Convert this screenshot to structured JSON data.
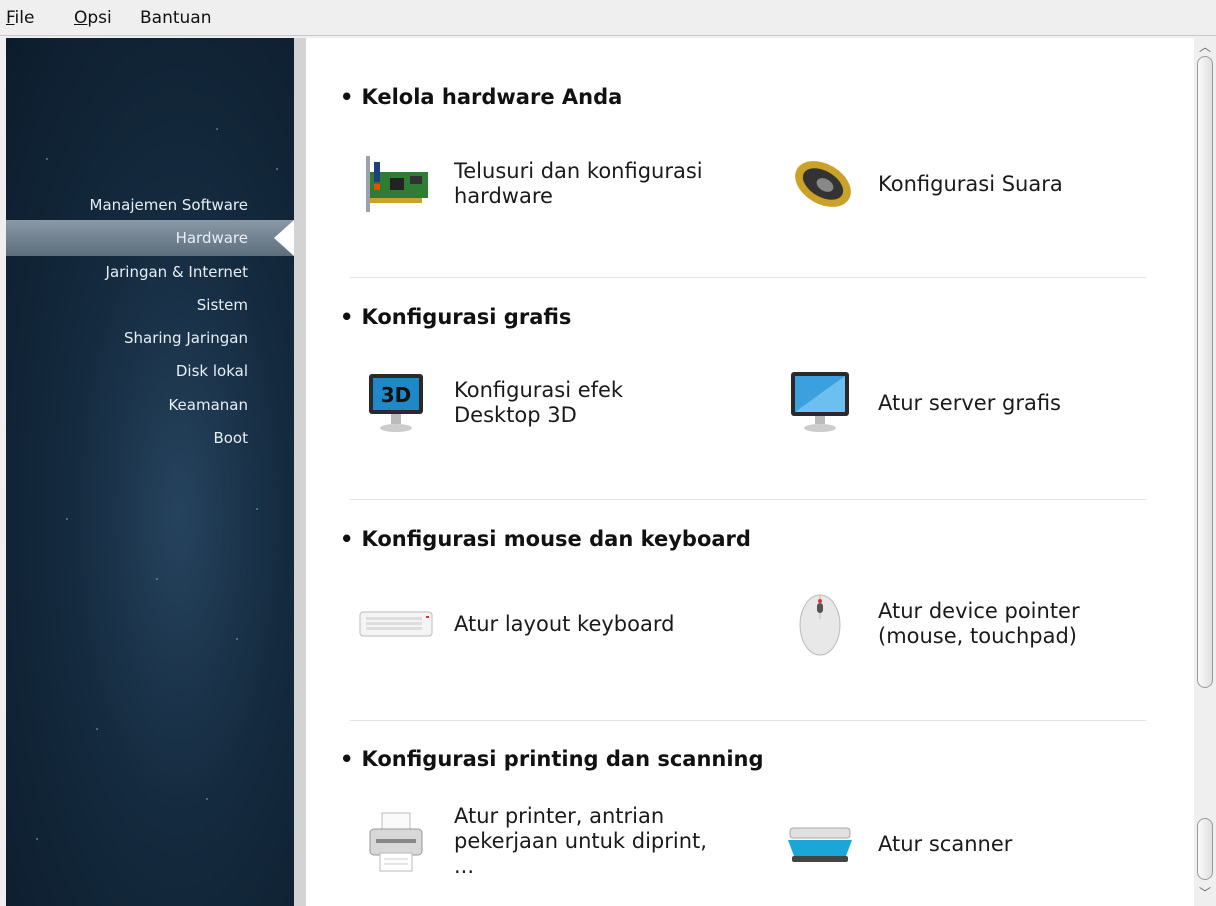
{
  "menubar": {
    "items": [
      {
        "label_first": "F",
        "label_rest": "ile"
      },
      {
        "label_first": "O",
        "label_rest": "psi"
      },
      {
        "label_first": "",
        "label_rest": "Bantuan"
      }
    ]
  },
  "sidebar": {
    "active": "Hardware",
    "items": [
      {
        "label": "Manajemen Software"
      },
      {
        "label": "Hardware"
      },
      {
        "label": "Jaringan & Internet"
      },
      {
        "label": "Sistem"
      },
      {
        "label": "Sharing Jaringan"
      },
      {
        "label": "Disk lokal"
      },
      {
        "label": "Keamanan"
      },
      {
        "label": "Boot"
      }
    ]
  },
  "sections": [
    {
      "title": "Kelola hardware Anda",
      "items": [
        {
          "icon": "pci-card-icon",
          "label": "Telusuri dan konfigurasi hardware"
        },
        {
          "icon": "speaker-icon",
          "label": "Konfigurasi Suara"
        }
      ]
    },
    {
      "title": "Konfigurasi grafis",
      "items": [
        {
          "icon": "monitor-3d-icon",
          "label": "Konfigurasi efek Desktop 3D"
        },
        {
          "icon": "monitor-icon",
          "label": "Atur server grafis"
        }
      ]
    },
    {
      "title": "Konfigurasi mouse dan keyboard",
      "items": [
        {
          "icon": "keyboard-icon",
          "label": "Atur layout keyboard"
        },
        {
          "icon": "mouse-icon",
          "label": "Atur device pointer (mouse, touchpad)"
        }
      ]
    },
    {
      "title": "Konfigurasi printing dan scanning",
      "items": [
        {
          "icon": "printer-icon",
          "label": "Atur printer, antrian pekerjaan untuk diprint, ..."
        },
        {
          "icon": "scanner-icon",
          "label": "Atur scanner"
        }
      ]
    }
  ],
  "icon_text": {
    "three_d": "3D"
  },
  "bullet": "•",
  "colors": {
    "sidebar_bg": "#142a3e",
    "active_band": "#7a8896",
    "content_bg": "#ffffff"
  }
}
